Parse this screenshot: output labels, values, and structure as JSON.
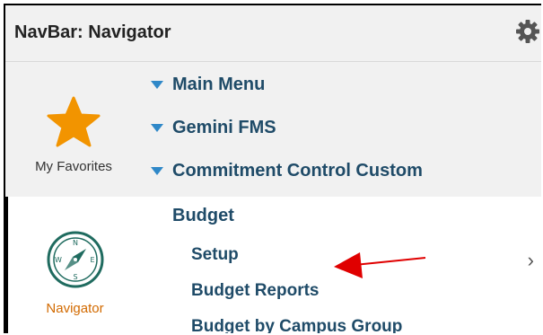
{
  "header": {
    "title": "NavBar: Navigator",
    "settings_icon": "gear-icon"
  },
  "rail": {
    "favorites": {
      "label": "My Favorites",
      "icon": "star-icon"
    },
    "navigator": {
      "label": "Navigator",
      "icon": "compass-icon"
    }
  },
  "tree": {
    "items": [
      {
        "label": "Main Menu",
        "expanded": true
      },
      {
        "label": "Gemini FMS",
        "expanded": true
      },
      {
        "label": "Commitment Control Custom",
        "expanded": true
      },
      {
        "label": "Budget"
      },
      {
        "label": "Setup",
        "has_children": true
      },
      {
        "label": "Budget Reports"
      },
      {
        "label": "Budget by Campus Group"
      }
    ]
  },
  "colors": {
    "accent_star": "#f29400",
    "nav_label": "#d26a00",
    "tree_text": "#1f4b68",
    "caret": "#2f88c8",
    "annotation_arrow": "#e00000",
    "compass": "#1f6b5f"
  }
}
